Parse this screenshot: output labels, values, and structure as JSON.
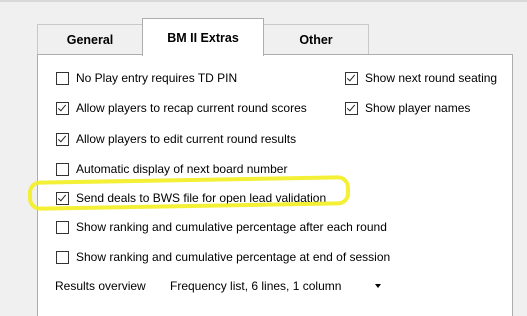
{
  "tabs": [
    {
      "label": "General",
      "selected": false
    },
    {
      "label": "BM II Extras",
      "selected": true
    },
    {
      "label": "Other",
      "selected": false
    }
  ],
  "options": {
    "no_play_pin": {
      "label": "No Play entry requires TD PIN",
      "checked": false
    },
    "show_next_seating": {
      "label": "Show next round seating",
      "checked": true
    },
    "recap_scores": {
      "label": "Allow players to recap current round scores",
      "checked": true
    },
    "show_player_names": {
      "label": "Show player names",
      "checked": true
    },
    "edit_results": {
      "label": "Allow players to edit current round results",
      "checked": true
    },
    "auto_board_number": {
      "label": "Automatic display of next board number",
      "checked": false
    },
    "send_deals_bws": {
      "label": "Send deals to BWS file for open lead validation",
      "checked": true
    },
    "ranking_each_round": {
      "label": "Show ranking and cumulative percentage after each round",
      "checked": false
    },
    "ranking_end_session": {
      "label": "Show ranking and cumulative percentage at end of session",
      "checked": false
    }
  },
  "results_overview": {
    "label": "Results overview",
    "selected": "Frequency list, 6 lines, 1 column"
  },
  "colors": {
    "highlight": "#f2ee20"
  }
}
